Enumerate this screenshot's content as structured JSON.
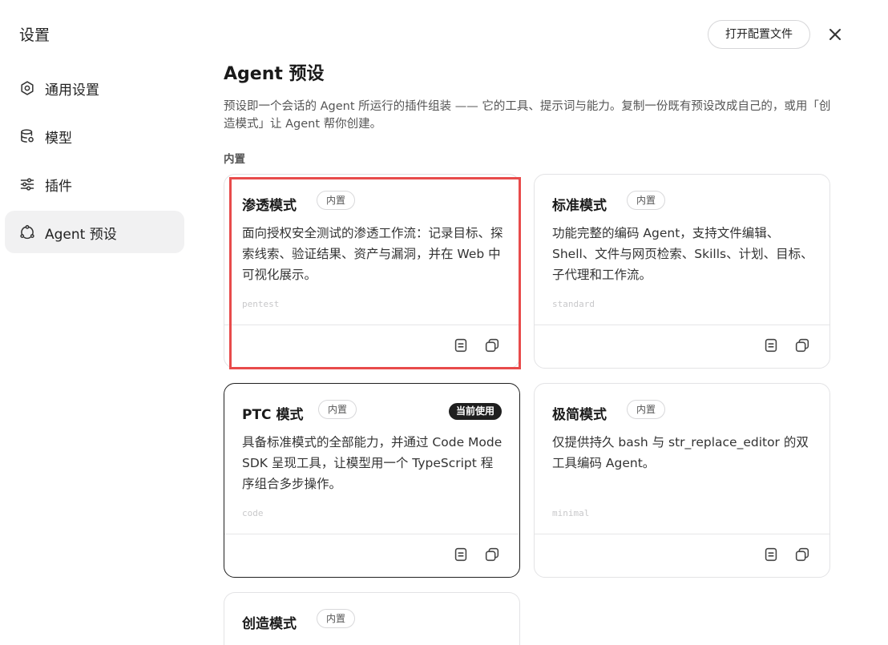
{
  "sidebar": {
    "title": "设置",
    "items": [
      {
        "label": "通用设置",
        "icon": "gear-icon"
      },
      {
        "label": "模型",
        "icon": "database-icon"
      },
      {
        "label": "插件",
        "icon": "sliders-icon"
      },
      {
        "label": "Agent 预设",
        "icon": "agent-icon",
        "active": true
      }
    ]
  },
  "header": {
    "open_config_label": "打开配置文件",
    "close_icon": "close-icon"
  },
  "main": {
    "title": "Agent 预设",
    "description": "预设即一个会话的 Agent 所运行的插件组装 —— 它的工具、提示词与能力。复制一份既有预设改成自己的，或用「创造模式」让 Agent 帮你创建。",
    "section_label": "内置",
    "cards": [
      {
        "title": "渗透模式",
        "badge": "内置",
        "description": "面向授权安全测试的渗透工作流：记录目标、探索线索、验证结果、资产与漏洞，并在 Web 中可视化展示。",
        "id": "pentest"
      },
      {
        "title": "标准模式",
        "badge": "内置",
        "description": "功能完整的编码 Agent，支持文件编辑、Shell、文件与网页检索、Skills、计划、目标、子代理和工作流。",
        "id": "standard"
      },
      {
        "title": "PTC 模式",
        "badge": "内置",
        "current_label": "当前使用",
        "description": "具备标准模式的全部能力，并通过 Code Mode SDK 呈现工具，让模型用一个 TypeScript 程序组合多步操作。",
        "id": "code"
      },
      {
        "title": "极简模式",
        "badge": "内置",
        "description": "仅提供持久 bash 与 str_replace_editor 的双工具编码 Agent。",
        "id": "minimal"
      },
      {
        "title": "创造模式",
        "badge": "内置"
      }
    ]
  },
  "colors": {
    "highlight": "#e84b4b",
    "current_badge_bg": "#1f1f1f",
    "active_nav_bg": "#f1f1f2"
  }
}
